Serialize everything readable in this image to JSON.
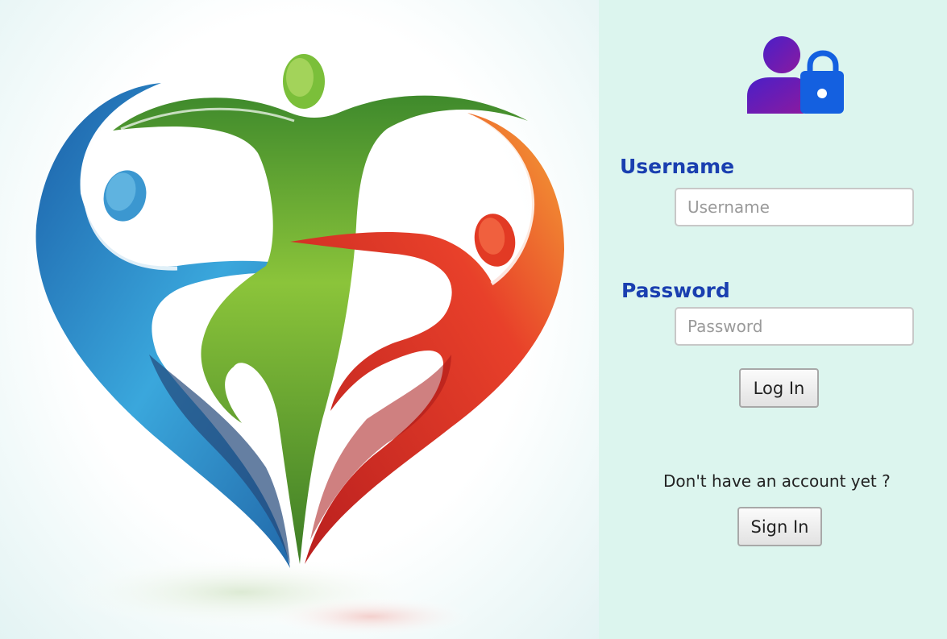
{
  "login_form": {
    "username_label": "Username",
    "username_placeholder": "Username",
    "password_label": "Password",
    "password_placeholder": "Password",
    "login_button": "Log In",
    "no_account_text": "Don't have an account yet ?",
    "signin_button": "Sign In"
  },
  "icons": {
    "header_icon": "user-lock-icon",
    "illustration": "heart-people-logo"
  },
  "colors": {
    "panel_background": "#dcf5ee",
    "label_color": "#1a3fb0",
    "icon_user_purple": "#6a1fb5",
    "icon_lock_blue": "#1460e0",
    "logo_blue": "#2a8fd0",
    "logo_green": "#6cc030",
    "logo_red": "#e8402a"
  }
}
